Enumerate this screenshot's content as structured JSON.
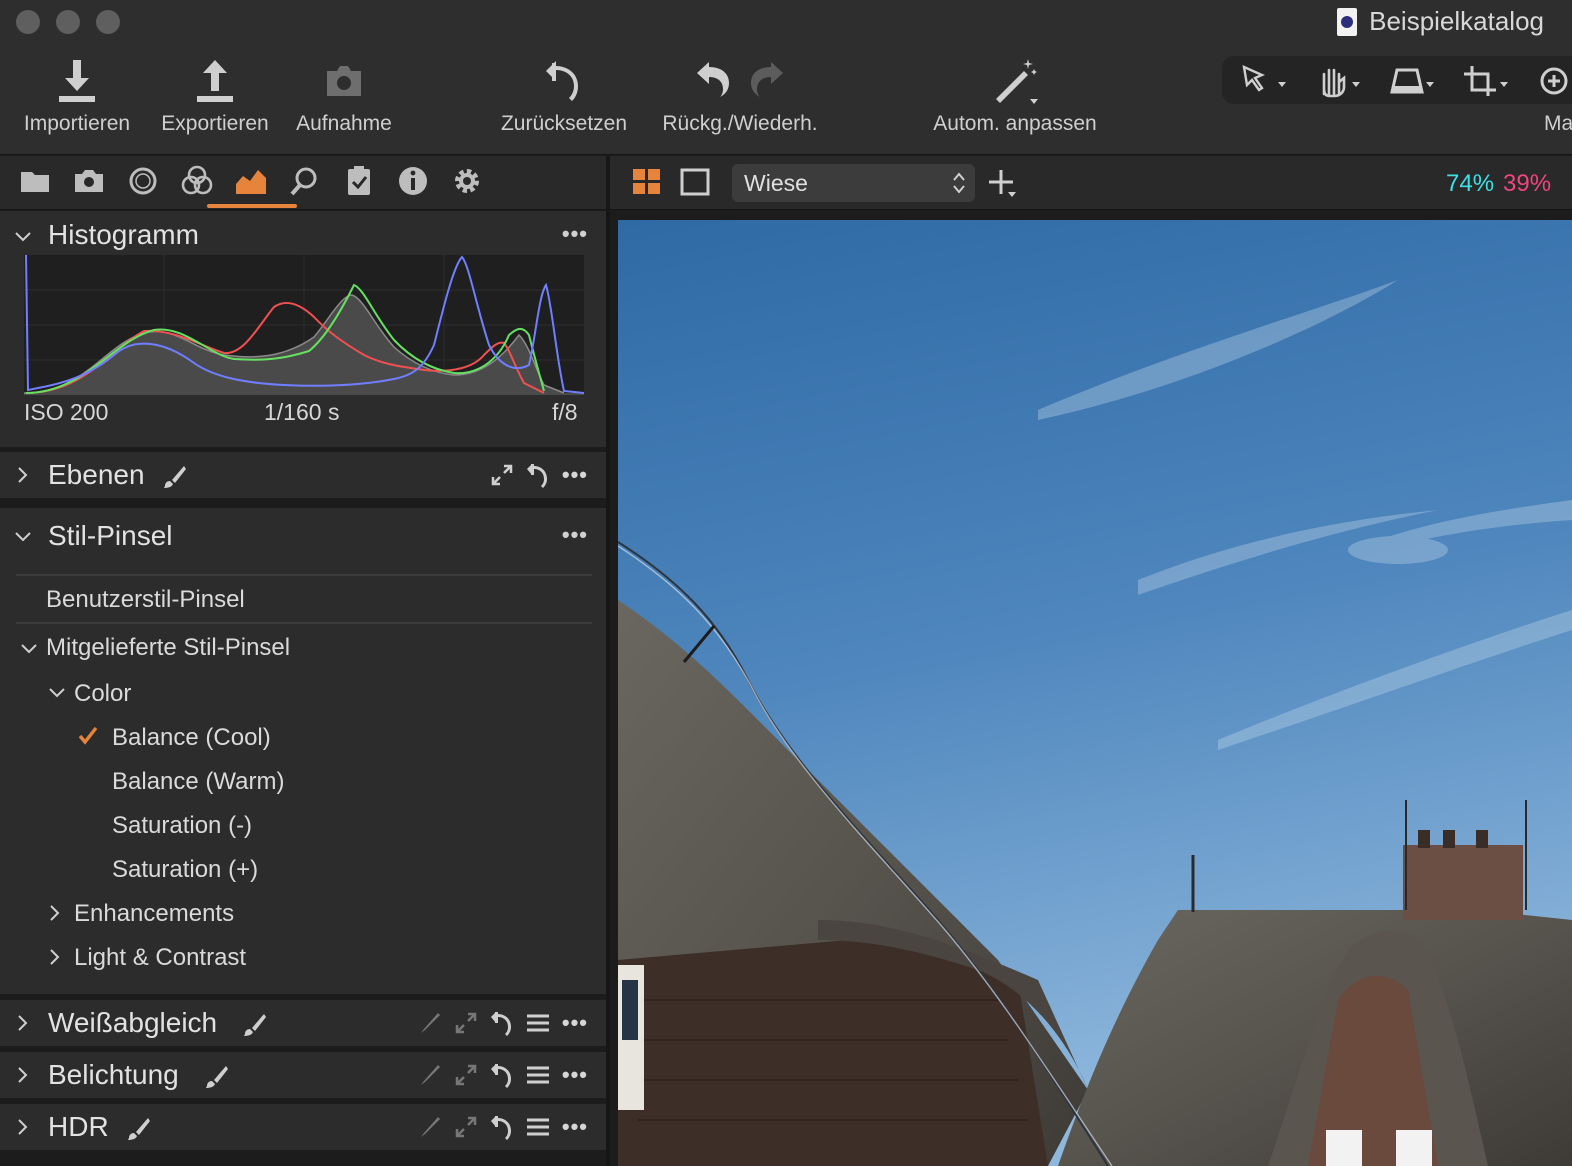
{
  "window": {
    "title": "Beispielkatalog"
  },
  "toolbar": {
    "import": "Importieren",
    "export": "Exportieren",
    "capture": "Aufnahme",
    "reset": "Zurücksetzen",
    "undo_redo": "Rückg./Wiederh.",
    "auto_adjust": "Autom. anpassen",
    "cut_label": "Ma"
  },
  "tool_tabs": [
    "library-icon",
    "camera-icon",
    "lens-icon",
    "color-icon",
    "exposure-icon",
    "search-icon",
    "clipboard-icon",
    "info-icon",
    "settings-icon"
  ],
  "histogram": {
    "title": "Histogramm",
    "iso": "ISO 200",
    "shutter": "1/160 s",
    "aperture": "f/8"
  },
  "panels": {
    "layers": {
      "title": "Ebenen"
    },
    "style_brushes": {
      "title": "Stil-Pinsel"
    },
    "white_balance": {
      "title": "Weißabgleich"
    },
    "exposure": {
      "title": "Belichtung"
    },
    "hdr": {
      "title": "HDR"
    }
  },
  "style_tree": {
    "user": "Benutzerstil-Pinsel",
    "builtin": "Mitgelieferte Stil-Pinsel",
    "color": "Color",
    "items": [
      "Balance (Cool)",
      "Balance (Warm)",
      "Saturation (-)",
      "Saturation (+)"
    ],
    "enhancements": "Enhancements",
    "light_contrast": "Light & Contrast"
  },
  "viewer": {
    "preset": "Wiese",
    "pct_a": "74%",
    "pct_b": "39%"
  },
  "colors": {
    "accent": "#e6843b",
    "cyan": "#3ee0e8",
    "magenta": "#f0457e"
  }
}
